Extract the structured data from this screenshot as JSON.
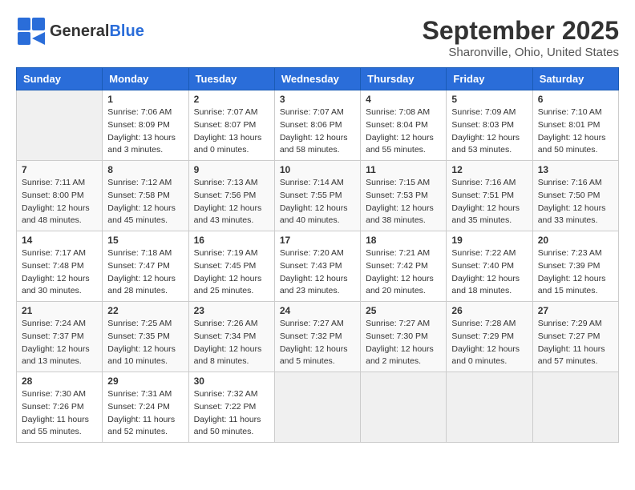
{
  "header": {
    "logo_general": "General",
    "logo_blue": "Blue",
    "month": "September 2025",
    "location": "Sharonville, Ohio, United States"
  },
  "weekdays": [
    "Sunday",
    "Monday",
    "Tuesday",
    "Wednesday",
    "Thursday",
    "Friday",
    "Saturday"
  ],
  "weeks": [
    [
      {
        "day": "",
        "info": ""
      },
      {
        "day": "1",
        "info": "Sunrise: 7:06 AM\nSunset: 8:09 PM\nDaylight: 13 hours\nand 3 minutes."
      },
      {
        "day": "2",
        "info": "Sunrise: 7:07 AM\nSunset: 8:07 PM\nDaylight: 13 hours\nand 0 minutes."
      },
      {
        "day": "3",
        "info": "Sunrise: 7:07 AM\nSunset: 8:06 PM\nDaylight: 12 hours\nand 58 minutes."
      },
      {
        "day": "4",
        "info": "Sunrise: 7:08 AM\nSunset: 8:04 PM\nDaylight: 12 hours\nand 55 minutes."
      },
      {
        "day": "5",
        "info": "Sunrise: 7:09 AM\nSunset: 8:03 PM\nDaylight: 12 hours\nand 53 minutes."
      },
      {
        "day": "6",
        "info": "Sunrise: 7:10 AM\nSunset: 8:01 PM\nDaylight: 12 hours\nand 50 minutes."
      }
    ],
    [
      {
        "day": "7",
        "info": "Sunrise: 7:11 AM\nSunset: 8:00 PM\nDaylight: 12 hours\nand 48 minutes."
      },
      {
        "day": "8",
        "info": "Sunrise: 7:12 AM\nSunset: 7:58 PM\nDaylight: 12 hours\nand 45 minutes."
      },
      {
        "day": "9",
        "info": "Sunrise: 7:13 AM\nSunset: 7:56 PM\nDaylight: 12 hours\nand 43 minutes."
      },
      {
        "day": "10",
        "info": "Sunrise: 7:14 AM\nSunset: 7:55 PM\nDaylight: 12 hours\nand 40 minutes."
      },
      {
        "day": "11",
        "info": "Sunrise: 7:15 AM\nSunset: 7:53 PM\nDaylight: 12 hours\nand 38 minutes."
      },
      {
        "day": "12",
        "info": "Sunrise: 7:16 AM\nSunset: 7:51 PM\nDaylight: 12 hours\nand 35 minutes."
      },
      {
        "day": "13",
        "info": "Sunrise: 7:16 AM\nSunset: 7:50 PM\nDaylight: 12 hours\nand 33 minutes."
      }
    ],
    [
      {
        "day": "14",
        "info": "Sunrise: 7:17 AM\nSunset: 7:48 PM\nDaylight: 12 hours\nand 30 minutes."
      },
      {
        "day": "15",
        "info": "Sunrise: 7:18 AM\nSunset: 7:47 PM\nDaylight: 12 hours\nand 28 minutes."
      },
      {
        "day": "16",
        "info": "Sunrise: 7:19 AM\nSunset: 7:45 PM\nDaylight: 12 hours\nand 25 minutes."
      },
      {
        "day": "17",
        "info": "Sunrise: 7:20 AM\nSunset: 7:43 PM\nDaylight: 12 hours\nand 23 minutes."
      },
      {
        "day": "18",
        "info": "Sunrise: 7:21 AM\nSunset: 7:42 PM\nDaylight: 12 hours\nand 20 minutes."
      },
      {
        "day": "19",
        "info": "Sunrise: 7:22 AM\nSunset: 7:40 PM\nDaylight: 12 hours\nand 18 minutes."
      },
      {
        "day": "20",
        "info": "Sunrise: 7:23 AM\nSunset: 7:39 PM\nDaylight: 12 hours\nand 15 minutes."
      }
    ],
    [
      {
        "day": "21",
        "info": "Sunrise: 7:24 AM\nSunset: 7:37 PM\nDaylight: 12 hours\nand 13 minutes."
      },
      {
        "day": "22",
        "info": "Sunrise: 7:25 AM\nSunset: 7:35 PM\nDaylight: 12 hours\nand 10 minutes."
      },
      {
        "day": "23",
        "info": "Sunrise: 7:26 AM\nSunset: 7:34 PM\nDaylight: 12 hours\nand 8 minutes."
      },
      {
        "day": "24",
        "info": "Sunrise: 7:27 AM\nSunset: 7:32 PM\nDaylight: 12 hours\nand 5 minutes."
      },
      {
        "day": "25",
        "info": "Sunrise: 7:27 AM\nSunset: 7:30 PM\nDaylight: 12 hours\nand 2 minutes."
      },
      {
        "day": "26",
        "info": "Sunrise: 7:28 AM\nSunset: 7:29 PM\nDaylight: 12 hours\nand 0 minutes."
      },
      {
        "day": "27",
        "info": "Sunrise: 7:29 AM\nSunset: 7:27 PM\nDaylight: 11 hours\nand 57 minutes."
      }
    ],
    [
      {
        "day": "28",
        "info": "Sunrise: 7:30 AM\nSunset: 7:26 PM\nDaylight: 11 hours\nand 55 minutes."
      },
      {
        "day": "29",
        "info": "Sunrise: 7:31 AM\nSunset: 7:24 PM\nDaylight: 11 hours\nand 52 minutes."
      },
      {
        "day": "30",
        "info": "Sunrise: 7:32 AM\nSunset: 7:22 PM\nDaylight: 11 hours\nand 50 minutes."
      },
      {
        "day": "",
        "info": ""
      },
      {
        "day": "",
        "info": ""
      },
      {
        "day": "",
        "info": ""
      },
      {
        "day": "",
        "info": ""
      }
    ]
  ]
}
